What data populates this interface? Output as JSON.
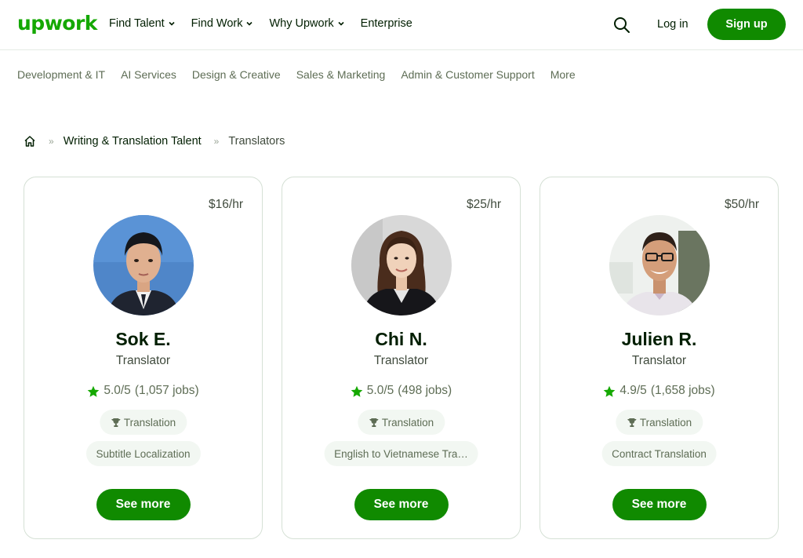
{
  "header": {
    "logo": "upwork",
    "nav": [
      {
        "label": "Find Talent",
        "dropdown": true
      },
      {
        "label": "Find Work",
        "dropdown": true
      },
      {
        "label": "Why Upwork",
        "dropdown": true
      },
      {
        "label": "Enterprise",
        "dropdown": false
      }
    ],
    "search_icon": "search-icon",
    "login_label": "Log in",
    "signup_label": "Sign up"
  },
  "categories": [
    "Development & IT",
    "AI Services",
    "Design & Creative",
    "Sales & Marketing",
    "Admin & Customer Support",
    "More"
  ],
  "breadcrumb": {
    "home_icon": "home-icon",
    "separator": "»",
    "link": "Writing & Translation Talent",
    "current": "Translators"
  },
  "freelancers": [
    {
      "rate": "$16/hr",
      "name": "Sok E.",
      "title": "Translator",
      "rating": "5.0/5",
      "jobs": "(1,057 jobs)",
      "badge_skill": "Translation",
      "skill": "Subtitle Localization",
      "cta": "See more"
    },
    {
      "rate": "$25/hr",
      "name": "Chi N.",
      "title": "Translator",
      "rating": "5.0/5",
      "jobs": "(498 jobs)",
      "badge_skill": "Translation",
      "skill": "English to Vietnamese Tra…",
      "cta": "See more"
    },
    {
      "rate": "$50/hr",
      "name": "Julien R.",
      "title": "Translator",
      "rating": "4.9/5",
      "jobs": "(1,658 jobs)",
      "badge_skill": "Translation",
      "skill": "Contract Translation",
      "cta": "See more"
    }
  ],
  "colors": {
    "brand_green": "#14a800",
    "button_green": "#108a00",
    "text_dark": "#001e00",
    "text_muted": "#5e6d55",
    "tag_bg": "#f2f7f2"
  }
}
